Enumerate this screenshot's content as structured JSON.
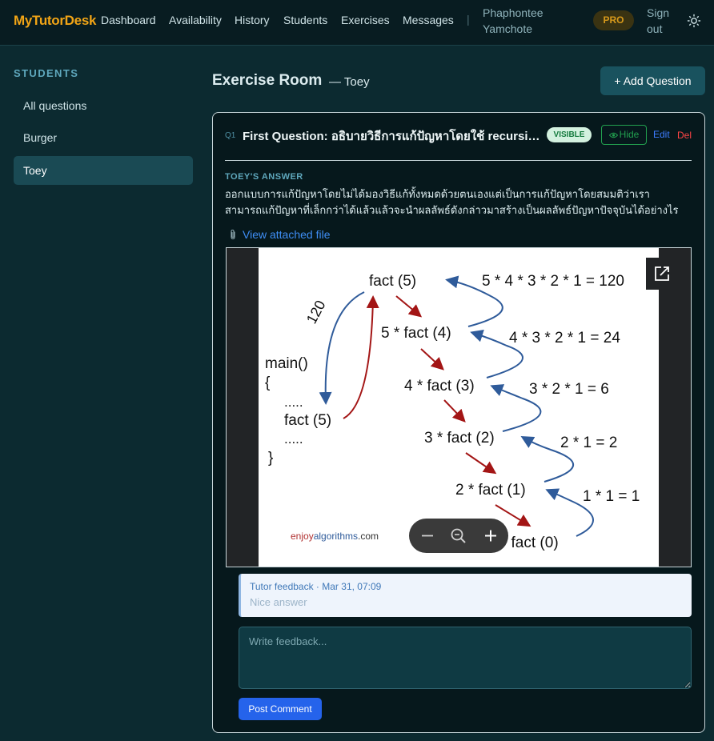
{
  "brand": {
    "logo": "MyTutorDesk",
    "color": "#f2a516"
  },
  "nav": {
    "links": [
      "Dashboard",
      "Availability",
      "History",
      "Students",
      "Exercises",
      "Messages"
    ],
    "separator": "|",
    "user_name": "Phaphontee Yamchote",
    "plan_badge": "PRO",
    "signout": "Sign out",
    "theme_icon": "sun-icon"
  },
  "sidebar": {
    "title": "STUDENTS",
    "items": [
      {
        "label": "All questions",
        "active": false
      },
      {
        "label": "Burger",
        "active": false
      },
      {
        "label": "Toey",
        "active": true
      }
    ]
  },
  "header": {
    "title": "Exercise Room",
    "subtitle": "— Toey",
    "add_button": "+ Add Question"
  },
  "question": {
    "number": "Q1",
    "title": "First Question: อธิบายวิธีการแก้ปัญหาโดยใช้ recursion",
    "visibility_badge": "VISIBLE",
    "hide_button": "Hide",
    "edit_link": "Edit",
    "delete_link": "Del",
    "answer_label": "TOEY'S ANSWER",
    "answer_lines": [
      "ออกแบบการแก้ปัญหาโดยไม่ได้มองวิธีแก้ทั้งหมดด้วยตนเองแต่เป็นการแก้ปัญหาโดยสมมติว่าเรา",
      "สามารถแก้ปัญหาที่เล็กกว่าได้แล้วแล้วจะนำผลลัพธ์ดังกล่าวมาสร้างเป็นผลลัพธ์ปัญหาปัจจุบันได้อย่างไร"
    ],
    "attachment_link": "View attached file"
  },
  "diagram": {
    "calls": [
      "fact (5)",
      "5 * fact (4)",
      "4 * fact (3)",
      "3 * fact (2)",
      "2 * fact (1)",
      "1 * fact (0)"
    ],
    "results": [
      "5 * 4 * 3 * 2 * 1 = 120",
      "4 * 3 * 2 * 1 = 24",
      "3 * 2 * 1 = 6",
      "2 * 1 = 2",
      "1 * 1 = 1"
    ],
    "main_lines": [
      "main()",
      "{",
      ".....",
      "fact (5)",
      ".....",
      "}"
    ],
    "return_label": "120",
    "watermark_parts": [
      "enjoy",
      "algorithms",
      ".com"
    ],
    "call_arrow_color": "#a31515",
    "return_arrow_color": "#2f5b9a"
  },
  "viewer": {
    "open_icon": "external-link-icon",
    "zoom_out_icon": "minus-icon",
    "zoom_reset_icon": "zoom-out-icon",
    "zoom_in_icon": "plus-icon"
  },
  "feedback": {
    "meta": "Tutor feedback · Mar 31, 07:09",
    "text": "Nice answer",
    "input_placeholder": "Write feedback...",
    "post_button": "Post Comment"
  }
}
